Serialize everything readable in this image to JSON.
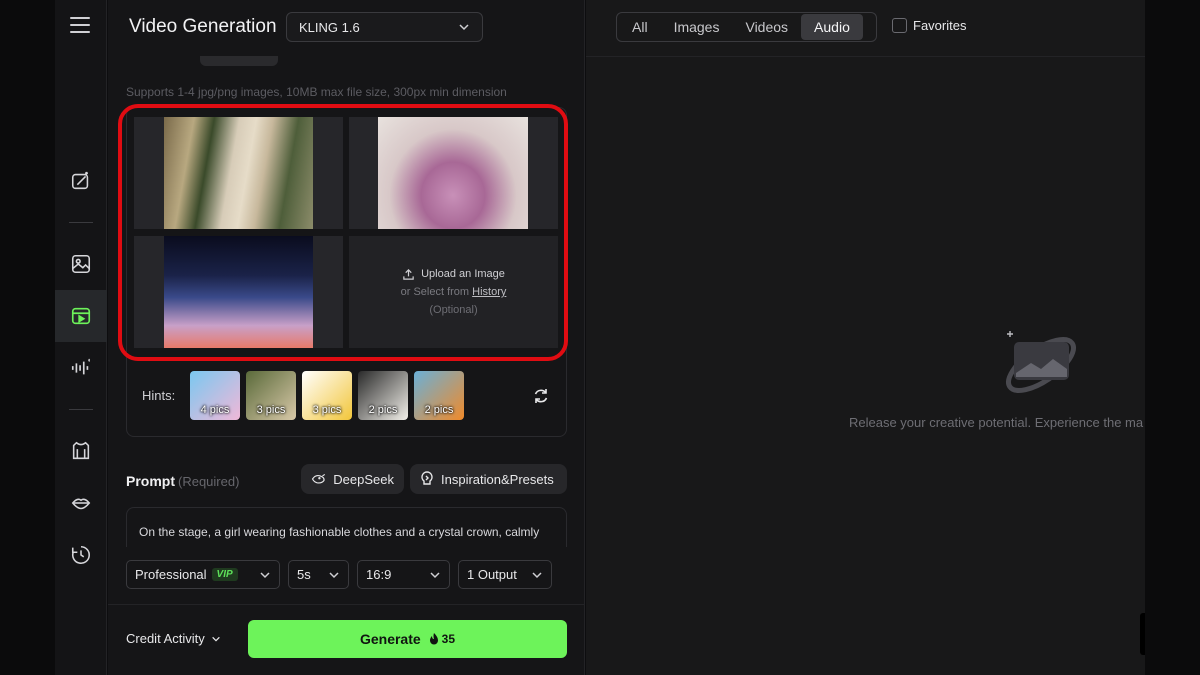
{
  "header": {
    "title": "Video Generation",
    "model": "KLING 1.6"
  },
  "upload": {
    "supports_text": "Supports 1-4 jpg/png images, 10MB max file size, 300px min dimension",
    "images": [
      {
        "name": "woman-in-silk-robe"
      },
      {
        "name": "crystal-crown"
      },
      {
        "name": "stage-runway"
      }
    ],
    "slot": {
      "upload_label": "Upload an Image",
      "select_prefix": "or Select from",
      "history_link": "History",
      "optional": "(Optional)"
    }
  },
  "hints": {
    "label": "Hints:",
    "items": [
      {
        "count": "4 pics"
      },
      {
        "count": "3 pics"
      },
      {
        "count": "3 pics"
      },
      {
        "count": "2 pics"
      },
      {
        "count": "2 pics"
      }
    ]
  },
  "prompt": {
    "label": "Prompt",
    "required": "(Required)",
    "deepseek": "DeepSeek",
    "presets": "Inspiration&Presets",
    "text": "On the stage, a girl wearing fashionable clothes and a crystal crown, calmly"
  },
  "settings": {
    "mode": "Professional",
    "vip": "VIP",
    "duration": "5s",
    "aspect": "16:9",
    "outputs": "1 Output"
  },
  "footer": {
    "credit": "Credit Activity",
    "generate": "Generate",
    "cost": "35"
  },
  "results": {
    "filters": [
      {
        "label": "All",
        "active": false
      },
      {
        "label": "Images",
        "active": false
      },
      {
        "label": "Videos",
        "active": false
      },
      {
        "label": "Audio",
        "active": true
      }
    ],
    "favorites": "Favorites",
    "empty_text": "Release your creative potential. Experience the ma"
  },
  "colors": {
    "accent": "#6df35a",
    "highlight": "#e00c12",
    "background": "#151517"
  }
}
